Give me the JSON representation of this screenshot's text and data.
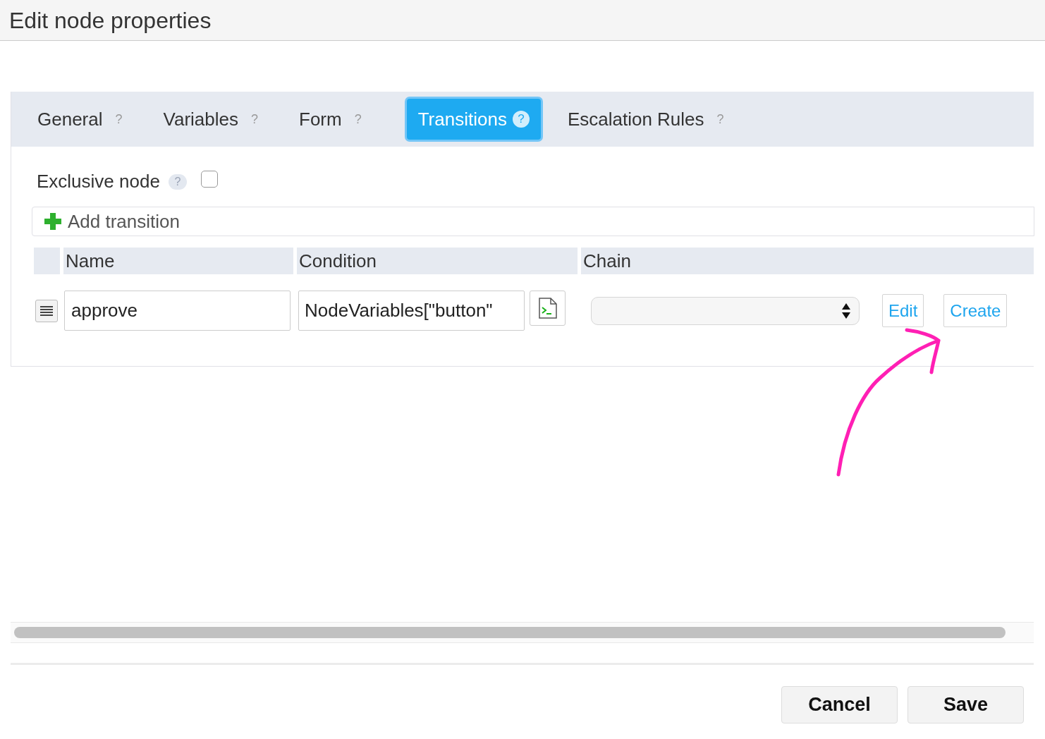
{
  "window": {
    "title": "Edit node properties"
  },
  "tabs": [
    {
      "label": "General",
      "help": "?",
      "selected": false
    },
    {
      "label": "Variables",
      "help": "?",
      "selected": false
    },
    {
      "label": "Form",
      "help": "?",
      "selected": false
    },
    {
      "label": "Transitions",
      "help": "?",
      "selected": true
    },
    {
      "label": "Escalation Rules",
      "help": "?",
      "selected": false
    }
  ],
  "exclusive_node": {
    "label": "Exclusive node",
    "help": "?",
    "checked": false
  },
  "add_transition": {
    "label": "Add transition"
  },
  "table": {
    "columns": [
      "Name",
      "Condition",
      "Chain"
    ],
    "rows": [
      {
        "name": "approve",
        "condition": "NodeVariables[\"button\"",
        "chain_buttons": [
          "Edit",
          "Create"
        ]
      }
    ]
  },
  "buttons": [
    "Cancel",
    "Save"
  ]
}
